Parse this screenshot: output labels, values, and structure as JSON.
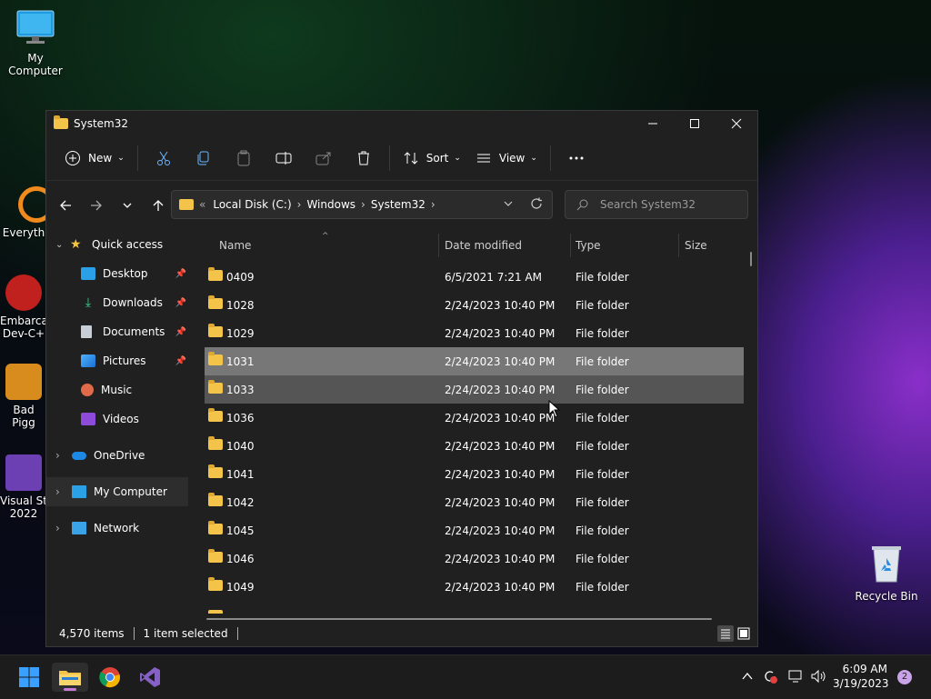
{
  "desktop": {
    "my_computer": "My Computer",
    "recycle_bin": "Recycle Bin",
    "partial_icons": [
      {
        "label": "Everyth"
      },
      {
        "label": "Embarca\nDev-C+"
      },
      {
        "label": "Bad Pigg"
      },
      {
        "label": "Visual St\n2022"
      }
    ]
  },
  "window": {
    "title": "System32",
    "toolbar": {
      "new_label": "New",
      "sort_label": "Sort",
      "view_label": "View"
    },
    "address": {
      "crumbs": [
        "Local Disk (C:)",
        "Windows",
        "System32"
      ],
      "back_glyph": "«"
    },
    "search": {
      "placeholder": "Search System32"
    },
    "nav": {
      "quick_access": "Quick access",
      "desktop": "Desktop",
      "downloads": "Downloads",
      "documents": "Documents",
      "pictures": "Pictures",
      "music": "Music",
      "videos": "Videos",
      "onedrive": "OneDrive",
      "my_computer": "My Computer",
      "network": "Network"
    },
    "columns": {
      "name": "Name",
      "date": "Date modified",
      "type": "Type",
      "size": "Size"
    },
    "rows": [
      {
        "name": "0409",
        "date": "6/5/2021 7:21 AM",
        "type": "File folder"
      },
      {
        "name": "1028",
        "date": "2/24/2023 10:40 PM",
        "type": "File folder"
      },
      {
        "name": "1029",
        "date": "2/24/2023 10:40 PM",
        "type": "File folder"
      },
      {
        "name": "1031",
        "date": "2/24/2023 10:40 PM",
        "type": "File folder"
      },
      {
        "name": "1033",
        "date": "2/24/2023 10:40 PM",
        "type": "File folder"
      },
      {
        "name": "1036",
        "date": "2/24/2023 10:40 PM",
        "type": "File folder"
      },
      {
        "name": "1040",
        "date": "2/24/2023 10:40 PM",
        "type": "File folder"
      },
      {
        "name": "1041",
        "date": "2/24/2023 10:40 PM",
        "type": "File folder"
      },
      {
        "name": "1042",
        "date": "2/24/2023 10:40 PM",
        "type": "File folder"
      },
      {
        "name": "1045",
        "date": "2/24/2023 10:40 PM",
        "type": "File folder"
      },
      {
        "name": "1046",
        "date": "2/24/2023 10:40 PM",
        "type": "File folder"
      },
      {
        "name": "1049",
        "date": "2/24/2023 10:40 PM",
        "type": "File folder"
      }
    ],
    "status": {
      "items": "4,570 items",
      "selected": "1 item selected"
    }
  },
  "taskbar": {
    "time": "6:09 AM",
    "date": "3/19/2023",
    "notifications": "2"
  }
}
